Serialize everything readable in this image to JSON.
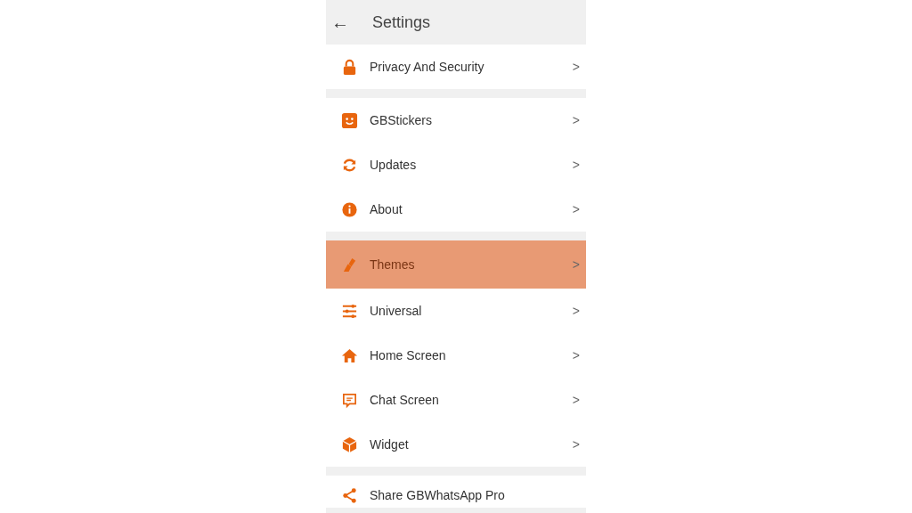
{
  "header": {
    "back": "←",
    "title": "Settings"
  },
  "groups": [
    [
      {
        "label": "Privacy And Security",
        "chevron": ">",
        "selected": false
      }
    ],
    [
      {
        "label": "GBStickers",
        "chevron": ">",
        "selected": false
      },
      {
        "label": "Updates",
        "chevron": ">",
        "selected": false
      },
      {
        "label": "About",
        "chevron": ">",
        "selected": false
      }
    ],
    [
      {
        "label": "Themes",
        "chevron": ">",
        "selected": true
      },
      {
        "label": "Universal",
        "chevron": ">",
        "selected": false
      },
      {
        "label": "Home Screen",
        "chevron": ">",
        "selected": false
      },
      {
        "label": "Chat Screen",
        "chevron": ">",
        "selected": false
      },
      {
        "label": "Widget",
        "chevron": ">",
        "selected": false
      }
    ],
    [
      {
        "label": "Share GBWhatsApp Pro",
        "selected": false
      }
    ]
  ]
}
